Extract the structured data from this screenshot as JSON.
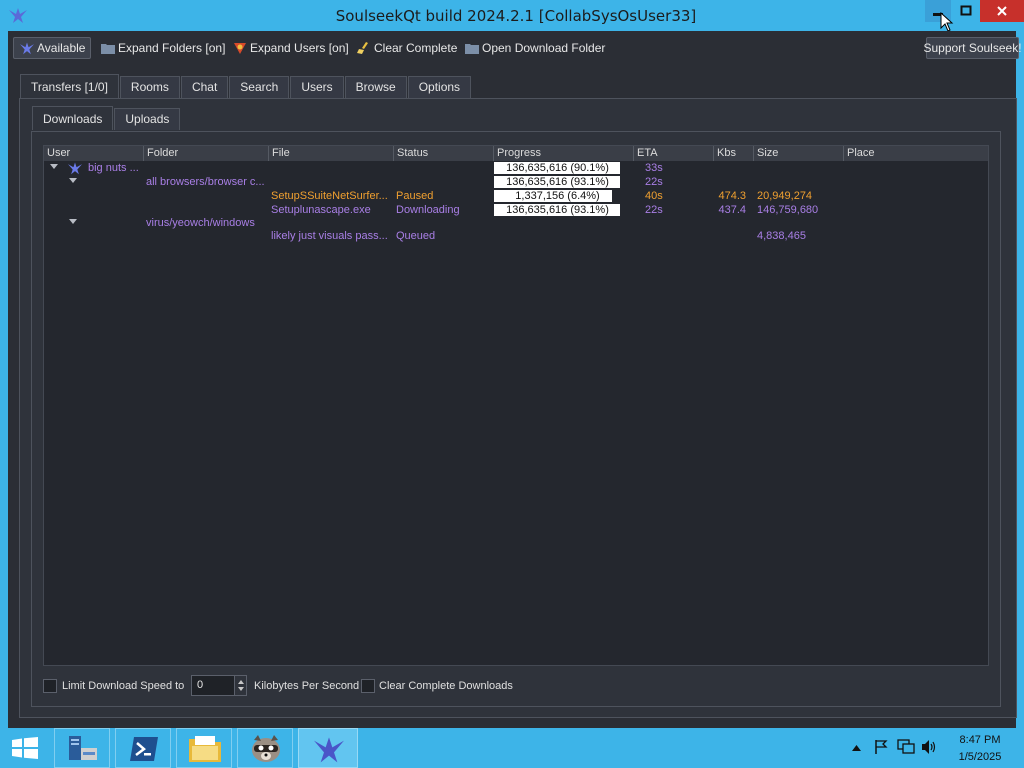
{
  "window": {
    "title": "SoulseekQt build 2024.2.1 [CollabSysOsUser33]"
  },
  "toolbar": {
    "available": "Available",
    "expand_folders": "Expand Folders [on]",
    "expand_users": "Expand Users [on]",
    "clear_complete": "Clear Complete",
    "open_download_folder": "Open Download Folder",
    "support": "Support Soulseek!"
  },
  "main_tabs": [
    "Transfers [1/0]",
    "Rooms",
    "Chat",
    "Search",
    "Users",
    "Browse",
    "Options"
  ],
  "sub_tabs": [
    "Downloads",
    "Uploads"
  ],
  "table": {
    "columns": [
      "User",
      "Folder",
      "File",
      "Status",
      "Progress",
      "ETA",
      "Kbs",
      "Size",
      "Place"
    ],
    "rows": [
      {
        "user": "big nuts ...",
        "folder": "",
        "file": "",
        "status": "",
        "progress": "136,635,616 (90.1%)",
        "progress_fraction": 0.901,
        "eta": "33s",
        "kbs": "",
        "size": "",
        "place": ""
      },
      {
        "user": "",
        "folder": "all browsers/browser c...",
        "file": "",
        "status": "",
        "progress": "136,635,616 (93.1%)",
        "progress_fraction": 0.931,
        "eta": "22s",
        "kbs": "",
        "size": "",
        "place": ""
      },
      {
        "user": "",
        "folder": "",
        "file": "SetupSSuiteNetSurfer...",
        "status": "Paused",
        "progress": "1,337,156 (6.4%)",
        "progress_fraction": 0.064,
        "eta": "40s",
        "kbs": "474.3",
        "size": "20,949,274",
        "place": ""
      },
      {
        "user": "",
        "folder": "",
        "file": "Setuplunascape.exe",
        "status": "Downloading",
        "progress": "136,635,616 (93.1%)",
        "progress_fraction": 0.931,
        "eta": "22s",
        "kbs": "437.4",
        "size": "146,759,680",
        "place": ""
      },
      {
        "user": "",
        "folder": "virus/yeowch/windows",
        "file": "",
        "status": "",
        "progress": "",
        "eta": "",
        "kbs": "",
        "size": "",
        "place": ""
      },
      {
        "user": "",
        "folder": "",
        "file": "likely just visuals pass...",
        "status": "Queued",
        "progress": "",
        "eta": "",
        "kbs": "",
        "size": "4,838,465",
        "place": ""
      }
    ]
  },
  "bottom": {
    "limit_label": "Limit Download Speed to",
    "speed_value": "0",
    "unit_label": "Kilobytes Per Second",
    "clear_label": "Clear Complete Downloads"
  },
  "taskbar": {
    "time": "8:47 PM",
    "date": "1/5/2025"
  },
  "colors": {
    "accent": "#3db4e8",
    "background": "#2b2e35",
    "purple_text": "#a97fe6",
    "orange_text": "#f0a030",
    "close_red": "#c7302b"
  },
  "icons": [
    "soulseek-bird-icon",
    "folder-icon",
    "users-icon",
    "broom-icon",
    "start-icon",
    "server-manager-icon",
    "powershell-icon",
    "file-explorer-icon",
    "raccoon-icon",
    "flag-icon",
    "network-icon",
    "speaker-icon"
  ]
}
